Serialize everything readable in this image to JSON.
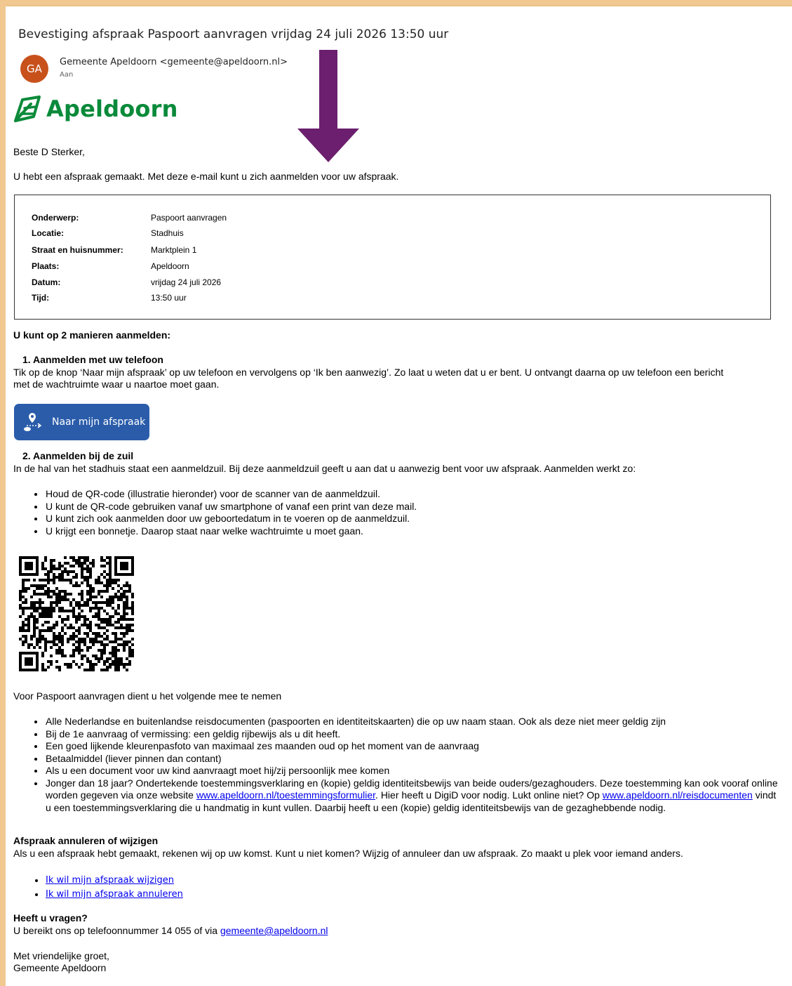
{
  "email": {
    "subject": "Bevestiging afspraak Paspoort aanvragen vrijdag 24 juli 2026 13:50 uur",
    "sender": "Gemeente Apeldoorn <gemeente@apeldoorn.nl>",
    "avatar_initials": "GA",
    "to_label": "Aan"
  },
  "logo": {
    "text": "Apeldoorn",
    "color": "#0a8a3a"
  },
  "greeting": "Beste D Sterker,",
  "intro": "U hebt een afspraak gemaakt. Met deze e-mail kunt u zich aanmelden voor uw afspraak.",
  "details": [
    {
      "label": "Onderwerp:",
      "value": "Paspoort aanvragen"
    },
    {
      "label": "Locatie:",
      "value": "Stadhuis"
    },
    {
      "label": "Straat en huisnummer:",
      "value": "Marktplein 1"
    },
    {
      "label": "Plaats:",
      "value": "Apeldoorn"
    },
    {
      "label": "Datum:",
      "value": "vrijdag 24 juli 2026"
    },
    {
      "label": "Tijd:",
      "value": "13:50 uur"
    }
  ],
  "ways_heading": "U kunt op 2 manieren aanmelden:",
  "phone": {
    "heading": "1. Aanmelden met uw telefoon",
    "text1": "Tik op de knop ‘Naar mijn afspraak’ op uw telefoon en vervolgens op ‘Ik ben aanwezig’. Zo laat u weten dat u er bent. U ontvangt daarna op uw telefoon een bericht",
    "text2": "met de wachtruimte waar u naartoe moet gaan.",
    "button_label": "Naar mijn afspraak"
  },
  "kiosk": {
    "heading": "2. Aanmelden bij de zuil",
    "text": "In de hal van het stadhuis staat een aanmeldzuil. Bij deze aanmeldzuil geeft u aan dat u aanwezig bent voor uw afspraak. Aanmelden werkt zo:",
    "items": [
      "Houd de QR-code (illustratie hieronder) voor de scanner van de aanmeldzuil.",
      "U kunt de QR-code gebruiken vanaf uw smartphone of vanaf een print van deze mail.",
      "U kunt zich ook aanmelden door uw geboortedatum in te voeren op de aanmeldzuil.",
      "U krijgt een bonnetje. Daarop staat naar welke wachtruimte u moet gaan."
    ]
  },
  "bring": {
    "intro": "Voor Paspoort aanvragen dient u het volgende mee te nemen",
    "items": [
      "Alle Nederlandse en buitenlandse reisdocumenten (paspoorten en identiteitskaarten) die op uw naam staan. Ook als deze niet meer geldig zijn",
      "Bij de 1e aanvraag of vermissing: een geldig rijbewijs als u dit heeft.",
      "Een goed lijkende kleurenpasfoto van maximaal zes maanden oud op het moment van de aanvraag",
      "Betaalmiddel (liever pinnen dan contant)",
      "Als u een document voor uw kind aanvraagt moet hij/zij persoonlijk mee komen"
    ],
    "last": {
      "part1": "Jonger dan 18 jaar? Ondertekende toestemmingsverklaring en (kopie) geldig identiteitsbewijs van beide ouders/gezaghouders. Deze toestemming kan ook vooraf online worden gegeven via onze website ",
      "link1": "www.apeldoorn.nl/toestemmingsformulier",
      "part2": ". Hier heeft u DigiD voor nodig. Lukt online niet? Op ",
      "link2": "www.apeldoorn.nl/reisdocumenten",
      "part3": " vindt u een toestemmingsverklaring die u handmatig in kunt vullen. Daarbij heeft u een (kopie) geldig identiteitsbewijs van de gezaghebbende nodig."
    }
  },
  "cancel": {
    "heading": "Afspraak annuleren of wijzigen",
    "text": "Als u een afspraak hebt gemaakt, rekenen wij op uw komst. Kunt u niet komen? Wijzig of annuleer dan uw afspraak. Zo maakt u plek voor iemand anders.",
    "links": [
      "Ik wil mijn afspraak wijzigen",
      "Ik wil mijn afspraak annuleren"
    ]
  },
  "questions": {
    "heading": "Heeft u vragen?",
    "text": "U bereikt ons op telefoonnummer 14 055 of via ",
    "email": "gemeente@apeldoorn.nl"
  },
  "closing": [
    "Met vriendelijke groet,",
    "Gemeente Apeldoorn"
  ],
  "colors": {
    "button": "#2a5caa",
    "arrow": "#6b1f6e",
    "avatar": "#c8511b",
    "page_border": "#f0c890"
  }
}
